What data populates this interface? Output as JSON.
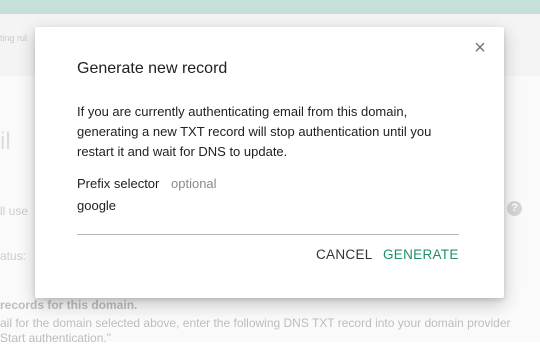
{
  "background": {
    "crumb": "ting rul",
    "heading": "il",
    "use_text": "ll use",
    "help_glyph": "?",
    "status_text": "atus:",
    "records_text": "records for this domain.",
    "desc_line1": "ail for the domain selected above, enter the following DNS TXT record into your domain provider",
    "desc_line2": "Start authentication.\""
  },
  "dialog": {
    "title": "Generate new record",
    "close_glyph": "×",
    "body_lines": [
      "If you are currently authenticating email from this domain,",
      "generating a new TXT record will stop authentication until you",
      "restart it and wait for DNS to update."
    ],
    "prefix": {
      "label": "Prefix selector",
      "optional": "optional",
      "value": "google"
    },
    "buttons": {
      "cancel": "CANCEL",
      "generate": "GENERATE"
    }
  },
  "colors": {
    "accent": "#1f8e6e",
    "top_strip": "#c4e0d9"
  }
}
